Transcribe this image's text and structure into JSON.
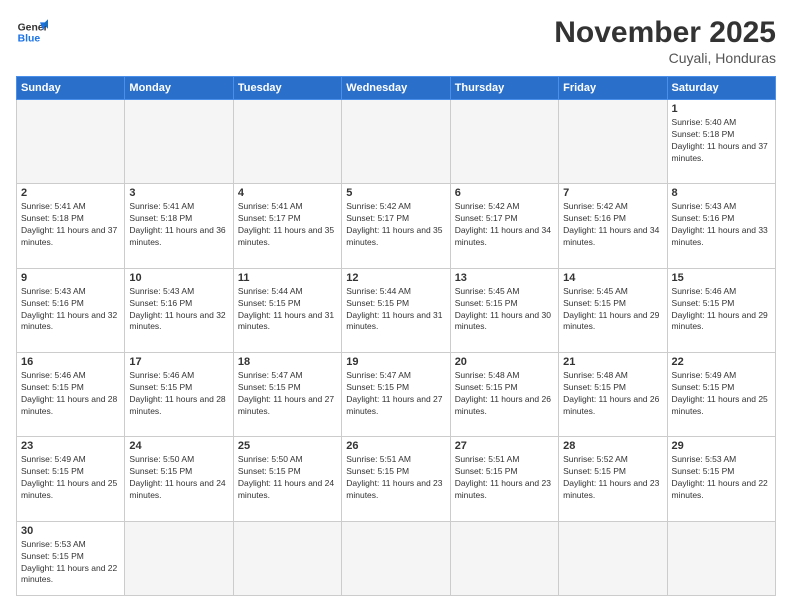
{
  "header": {
    "logo_general": "General",
    "logo_blue": "Blue",
    "month_title": "November 2025",
    "location": "Cuyali, Honduras"
  },
  "weekdays": [
    "Sunday",
    "Monday",
    "Tuesday",
    "Wednesday",
    "Thursday",
    "Friday",
    "Saturday"
  ],
  "weeks": [
    [
      {
        "num": "",
        "info": ""
      },
      {
        "num": "",
        "info": ""
      },
      {
        "num": "",
        "info": ""
      },
      {
        "num": "",
        "info": ""
      },
      {
        "num": "",
        "info": ""
      },
      {
        "num": "",
        "info": ""
      },
      {
        "num": "1",
        "info": "Sunrise: 5:40 AM\nSunset: 5:18 PM\nDaylight: 11 hours and 37 minutes."
      }
    ],
    [
      {
        "num": "2",
        "info": "Sunrise: 5:41 AM\nSunset: 5:18 PM\nDaylight: 11 hours and 37 minutes."
      },
      {
        "num": "3",
        "info": "Sunrise: 5:41 AM\nSunset: 5:18 PM\nDaylight: 11 hours and 36 minutes."
      },
      {
        "num": "4",
        "info": "Sunrise: 5:41 AM\nSunset: 5:17 PM\nDaylight: 11 hours and 35 minutes."
      },
      {
        "num": "5",
        "info": "Sunrise: 5:42 AM\nSunset: 5:17 PM\nDaylight: 11 hours and 35 minutes."
      },
      {
        "num": "6",
        "info": "Sunrise: 5:42 AM\nSunset: 5:17 PM\nDaylight: 11 hours and 34 minutes."
      },
      {
        "num": "7",
        "info": "Sunrise: 5:42 AM\nSunset: 5:16 PM\nDaylight: 11 hours and 34 minutes."
      },
      {
        "num": "8",
        "info": "Sunrise: 5:43 AM\nSunset: 5:16 PM\nDaylight: 11 hours and 33 minutes."
      }
    ],
    [
      {
        "num": "9",
        "info": "Sunrise: 5:43 AM\nSunset: 5:16 PM\nDaylight: 11 hours and 32 minutes."
      },
      {
        "num": "10",
        "info": "Sunrise: 5:43 AM\nSunset: 5:16 PM\nDaylight: 11 hours and 32 minutes."
      },
      {
        "num": "11",
        "info": "Sunrise: 5:44 AM\nSunset: 5:15 PM\nDaylight: 11 hours and 31 minutes."
      },
      {
        "num": "12",
        "info": "Sunrise: 5:44 AM\nSunset: 5:15 PM\nDaylight: 11 hours and 31 minutes."
      },
      {
        "num": "13",
        "info": "Sunrise: 5:45 AM\nSunset: 5:15 PM\nDaylight: 11 hours and 30 minutes."
      },
      {
        "num": "14",
        "info": "Sunrise: 5:45 AM\nSunset: 5:15 PM\nDaylight: 11 hours and 29 minutes."
      },
      {
        "num": "15",
        "info": "Sunrise: 5:46 AM\nSunset: 5:15 PM\nDaylight: 11 hours and 29 minutes."
      }
    ],
    [
      {
        "num": "16",
        "info": "Sunrise: 5:46 AM\nSunset: 5:15 PM\nDaylight: 11 hours and 28 minutes."
      },
      {
        "num": "17",
        "info": "Sunrise: 5:46 AM\nSunset: 5:15 PM\nDaylight: 11 hours and 28 minutes."
      },
      {
        "num": "18",
        "info": "Sunrise: 5:47 AM\nSunset: 5:15 PM\nDaylight: 11 hours and 27 minutes."
      },
      {
        "num": "19",
        "info": "Sunrise: 5:47 AM\nSunset: 5:15 PM\nDaylight: 11 hours and 27 minutes."
      },
      {
        "num": "20",
        "info": "Sunrise: 5:48 AM\nSunset: 5:15 PM\nDaylight: 11 hours and 26 minutes."
      },
      {
        "num": "21",
        "info": "Sunrise: 5:48 AM\nSunset: 5:15 PM\nDaylight: 11 hours and 26 minutes."
      },
      {
        "num": "22",
        "info": "Sunrise: 5:49 AM\nSunset: 5:15 PM\nDaylight: 11 hours and 25 minutes."
      }
    ],
    [
      {
        "num": "23",
        "info": "Sunrise: 5:49 AM\nSunset: 5:15 PM\nDaylight: 11 hours and 25 minutes."
      },
      {
        "num": "24",
        "info": "Sunrise: 5:50 AM\nSunset: 5:15 PM\nDaylight: 11 hours and 24 minutes."
      },
      {
        "num": "25",
        "info": "Sunrise: 5:50 AM\nSunset: 5:15 PM\nDaylight: 11 hours and 24 minutes."
      },
      {
        "num": "26",
        "info": "Sunrise: 5:51 AM\nSunset: 5:15 PM\nDaylight: 11 hours and 23 minutes."
      },
      {
        "num": "27",
        "info": "Sunrise: 5:51 AM\nSunset: 5:15 PM\nDaylight: 11 hours and 23 minutes."
      },
      {
        "num": "28",
        "info": "Sunrise: 5:52 AM\nSunset: 5:15 PM\nDaylight: 11 hours and 23 minutes."
      },
      {
        "num": "29",
        "info": "Sunrise: 5:53 AM\nSunset: 5:15 PM\nDaylight: 11 hours and 22 minutes."
      }
    ],
    [
      {
        "num": "30",
        "info": "Sunrise: 5:53 AM\nSunset: 5:15 PM\nDaylight: 11 hours and 22 minutes."
      },
      {
        "num": "",
        "info": ""
      },
      {
        "num": "",
        "info": ""
      },
      {
        "num": "",
        "info": ""
      },
      {
        "num": "",
        "info": ""
      },
      {
        "num": "",
        "info": ""
      },
      {
        "num": "",
        "info": ""
      }
    ]
  ]
}
